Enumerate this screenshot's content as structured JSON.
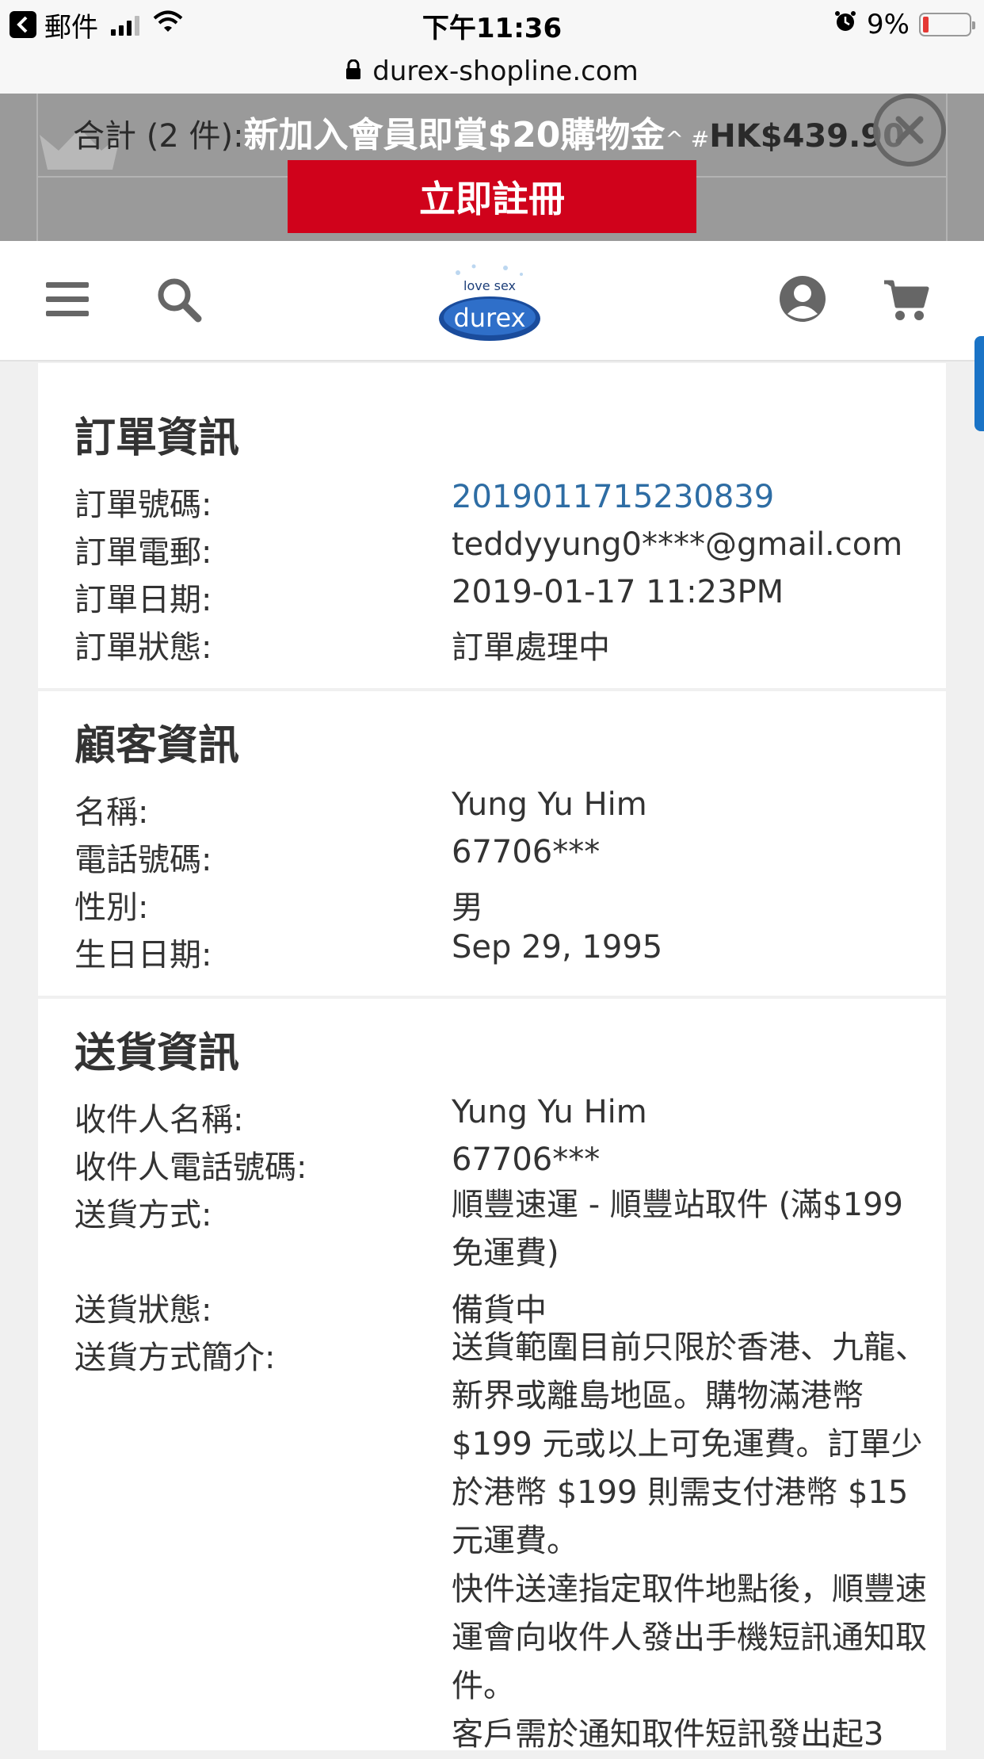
{
  "status_bar": {
    "back_app": "郵件",
    "time": "下午11:36",
    "battery": "9%"
  },
  "url_bar": {
    "domain": "durex-shopline.com"
  },
  "promo": {
    "total_text": "合計 (2 件):",
    "headline": "新加入會員即賞$20購物金",
    "marks": "^ #",
    "price": "HK$439.90",
    "register_label": "立即註冊"
  },
  "nav": {
    "logo_tagline": "love sex",
    "logo_brand": "durex"
  },
  "order_info": {
    "title": "訂單資訊",
    "rows": [
      {
        "label": "訂單號碼:",
        "value": "2019011715230839"
      },
      {
        "label": "訂單電郵:",
        "value": "teddyyung0****@gmail.com"
      },
      {
        "label": "訂單日期:",
        "value": "2019-01-17 11:23PM"
      },
      {
        "label": "訂單狀態:",
        "value": "訂單處理中"
      }
    ]
  },
  "customer_info": {
    "title": "顧客資訊",
    "rows": [
      {
        "label": "名稱:",
        "value": "Yung Yu Him"
      },
      {
        "label": "電話號碼:",
        "value": "67706***"
      },
      {
        "label": "性別:",
        "value": "男"
      },
      {
        "label": "生日日期:",
        "value": "Sep 29, 1995"
      }
    ]
  },
  "delivery_info": {
    "title": "送貨資訊",
    "rows": [
      {
        "label": "收件人名稱:",
        "value": "Yung Yu Him"
      },
      {
        "label": "收件人電話號碼:",
        "value": "67706***"
      },
      {
        "label": "送貨方式:",
        "value": "順豐速運 - 順豐站取件 (滿$199免運費)"
      },
      {
        "label": "送貨狀態:",
        "value": "備貨中"
      },
      {
        "label": "送貨方式簡介:",
        "value": "送貨範圍目前只限於香港、九龍、新界或離島地區。購物滿港幣 $199 元或以上可免運費。訂單少於港幣 $199 則需支付港幣 $15 元運費。"
      }
    ],
    "note_2": "快件送達指定取件地點後，順豐速運會向收件人發出手機短訊通知取件。",
    "note_3": "客戶需於通知取件短訊發出起3"
  }
}
